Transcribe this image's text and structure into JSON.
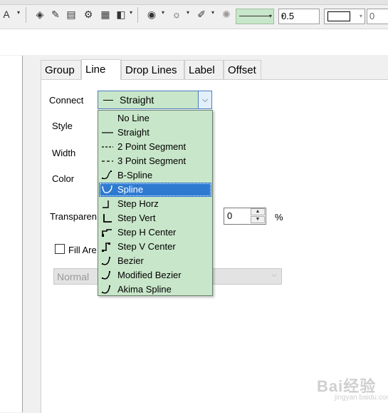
{
  "toolbar": {
    "line_width_value": "0.5",
    "number_value": "0"
  },
  "tabs": [
    {
      "label": "Group"
    },
    {
      "label": "Line"
    },
    {
      "label": "Drop Lines"
    },
    {
      "label": "Label"
    },
    {
      "label": "Offset"
    }
  ],
  "form": {
    "connect_label": "Connect",
    "connect_value": "Straight",
    "style_label": "Style",
    "width_label": "Width",
    "color_label": "Color",
    "transparency_label": "Transparen",
    "transparency_value": "0",
    "percent": "%",
    "fill_area_label": "Fill Are",
    "fill_mode_value": "Normal"
  },
  "connect_options": [
    {
      "label": "No Line",
      "icon": "none"
    },
    {
      "label": "Straight",
      "icon": "straight-line-icon"
    },
    {
      "label": "2 Point Segment",
      "icon": "dashed-line-icon"
    },
    {
      "label": "3 Point Segment",
      "icon": "dashed-line-icon"
    },
    {
      "label": "B-Spline",
      "icon": "b-spline-icon"
    },
    {
      "label": "Spline",
      "icon": "spline-icon",
      "selected": true
    },
    {
      "label": "Step Horz",
      "icon": "step-horz-icon"
    },
    {
      "label": "Step Vert",
      "icon": "step-vert-icon"
    },
    {
      "label": "Step H Center",
      "icon": "step-h-center-icon"
    },
    {
      "label": "Step V Center",
      "icon": "step-v-center-icon"
    },
    {
      "label": "Bezier",
      "icon": "bezier-icon"
    },
    {
      "label": "Modified Bezier",
      "icon": "modified-bezier-icon"
    },
    {
      "label": "Akima Spline",
      "icon": "akima-spline-icon"
    }
  ],
  "colors": {
    "accent_green": "#c8e6c9",
    "selection_blue": "#2e7ad1"
  },
  "watermark": {
    "main": "Bai经验",
    "sub": "jingyan.baidu.com"
  }
}
